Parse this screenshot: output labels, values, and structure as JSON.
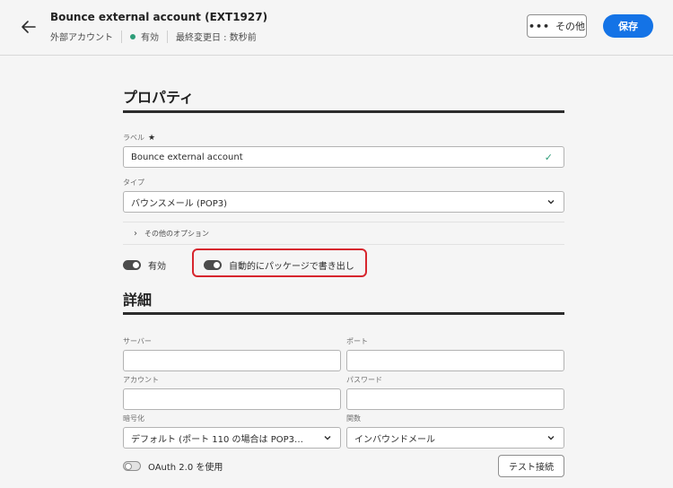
{
  "header": {
    "title": "Bounce external account (EXT1927)",
    "type_label": "外部アカウント",
    "status": "有効",
    "last_modified": "最終変更日 : 数秒前",
    "more_label": "その他",
    "save_label": "保存"
  },
  "properties": {
    "section_title": "プロパティ",
    "label_field": {
      "label": "ラベル",
      "required_mark": "★",
      "value": "Bounce external account"
    },
    "type_field": {
      "label": "タイプ",
      "value": "バウンスメール (POP3)"
    },
    "other_options": "その他のオプション",
    "enabled_toggle": {
      "label": "有効",
      "on": true
    },
    "export_toggle": {
      "label": "自動的にパッケージで書き出し",
      "on": true
    }
  },
  "details": {
    "section_title": "詳細",
    "server": {
      "label": "サーバー",
      "value": ""
    },
    "port": {
      "label": "ポート",
      "value": ""
    },
    "account": {
      "label": "アカウント",
      "value": ""
    },
    "password": {
      "label": "パスワード",
      "value": ""
    },
    "encryption": {
      "label": "暗号化",
      "value": "デフォルト (ポート 110 の場合は POP3…"
    },
    "function": {
      "label": "関数",
      "value": "インバウンドメール"
    },
    "oauth_toggle": {
      "label": "OAuth 2.0 を使用",
      "on": false
    },
    "test_button": "テスト接続"
  },
  "colors": {
    "accent": "#1473e6",
    "status_green": "#2d9d78",
    "highlight_red": "#d7262e"
  }
}
